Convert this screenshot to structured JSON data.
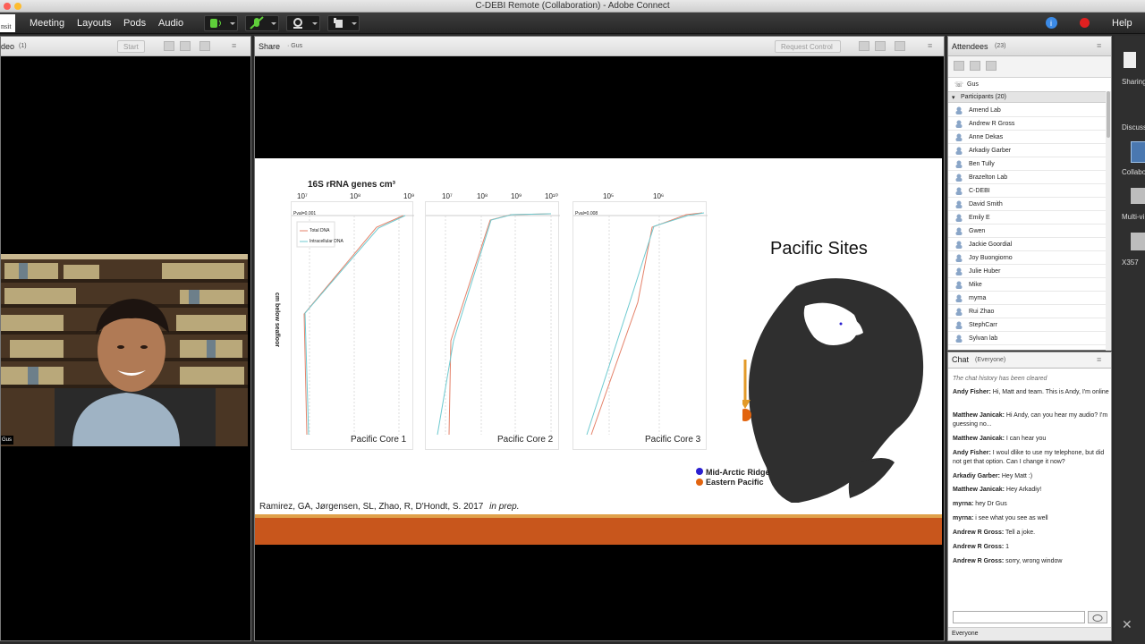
{
  "window": {
    "title": "C-DEBI Remote (Collaboration) - Adobe Connect"
  },
  "menubar": {
    "items": [
      "Meeting",
      "Layouts",
      "Pods",
      "Audio"
    ],
    "help_label": "Help"
  },
  "video_pod": {
    "title": "deo",
    "count": "(1)",
    "start_label": "Start",
    "user_tag": "Gus"
  },
  "share_pod": {
    "title": "Share",
    "presenter": "· Gus",
    "request_control_label": "Request Control"
  },
  "slide": {
    "chart_header": "16S rRNA genes cm³",
    "y_axis_label": "cm below seafloor",
    "panels": [
      {
        "label": "Pacific Core 1",
        "pval": "Pval=0.001",
        "ticks": [
          "10⁷",
          "10⁸",
          "10⁹"
        ]
      },
      {
        "label": "Pacific Core 2",
        "pval": "",
        "ticks": [
          "10⁷",
          "10⁸",
          "10⁹",
          "10¹⁰"
        ]
      },
      {
        "label": "Pacific Core 3",
        "pval": "Pval=0.008",
        "ticks": [
          "10⁵",
          "10⁶"
        ]
      }
    ],
    "legend": {
      "total": "Total DNA",
      "intracellular": "Intracellular DNA"
    },
    "map_title": "Pacific Sites",
    "map_legend": [
      {
        "label": "Mid-Arctic Ridge",
        "color": "#2a1fd0"
      },
      {
        "label": "Eastern Pacific",
        "color": "#e2640f"
      }
    ],
    "citation": "Ramirez, GA, Jørgensen, SL, Zhao, R, D'Hondt, S. 2017",
    "citation_note": "in prep.",
    "accent_color": "#c8561c"
  },
  "attendees": {
    "title": "Attendees",
    "count": "(23)",
    "host": "Gus",
    "participants_header": "Participants (20)",
    "participants": [
      "Amend Lab",
      "Andrew R Gross",
      "Anne Dekas",
      "Arkadiy Garber",
      "Ben Tully",
      "Brazelton Lab",
      "C-DEBI",
      "David Smith",
      "Emily E",
      "Gwen",
      "Jackie Goordial",
      "Joy Buongiorno",
      "Julie Huber",
      "Mike",
      "myrna",
      "Rui Zhao",
      "StephCarr",
      "Sylvan lab"
    ]
  },
  "chat": {
    "title": "Chat",
    "scope": "(Everyone)",
    "cleared_notice": "The chat history has been cleared",
    "messages": [
      {
        "sender": "Andy Fisher:",
        "text": "Hi, Matt and team. This is Andy, I'm online"
      },
      {
        "sender": "Matthew Janicak:",
        "text": "Hi Andy, can you hear my audio? I'm guessing no..."
      },
      {
        "sender": "Matthew Janicak:",
        "text": "I can hear you"
      },
      {
        "sender": "Andy Fisher:",
        "text": "I woul dlike to use my telephone, but did not get that option. Can I change it now?"
      },
      {
        "sender": "Arkadiy Garber:",
        "text": "Hey Matt :)"
      },
      {
        "sender": "Matthew Janicak:",
        "text": "Hey Arkadiy!"
      },
      {
        "sender": "myrna:",
        "text": "hey Dr Gus"
      },
      {
        "sender": "myrna:",
        "text": "i see what you see as well"
      },
      {
        "sender": "Andrew R Gross:",
        "text": "Tell a joke."
      },
      {
        "sender": "Andrew R Gross:",
        "text": "1"
      },
      {
        "sender": "Andrew R Gross:",
        "text": "sorry, wrong window"
      }
    ],
    "recipient": "Everyone"
  },
  "right_rail": {
    "items": [
      "Sharing",
      "Discuss",
      "Collabo",
      "Multi-vi",
      "X357"
    ]
  }
}
